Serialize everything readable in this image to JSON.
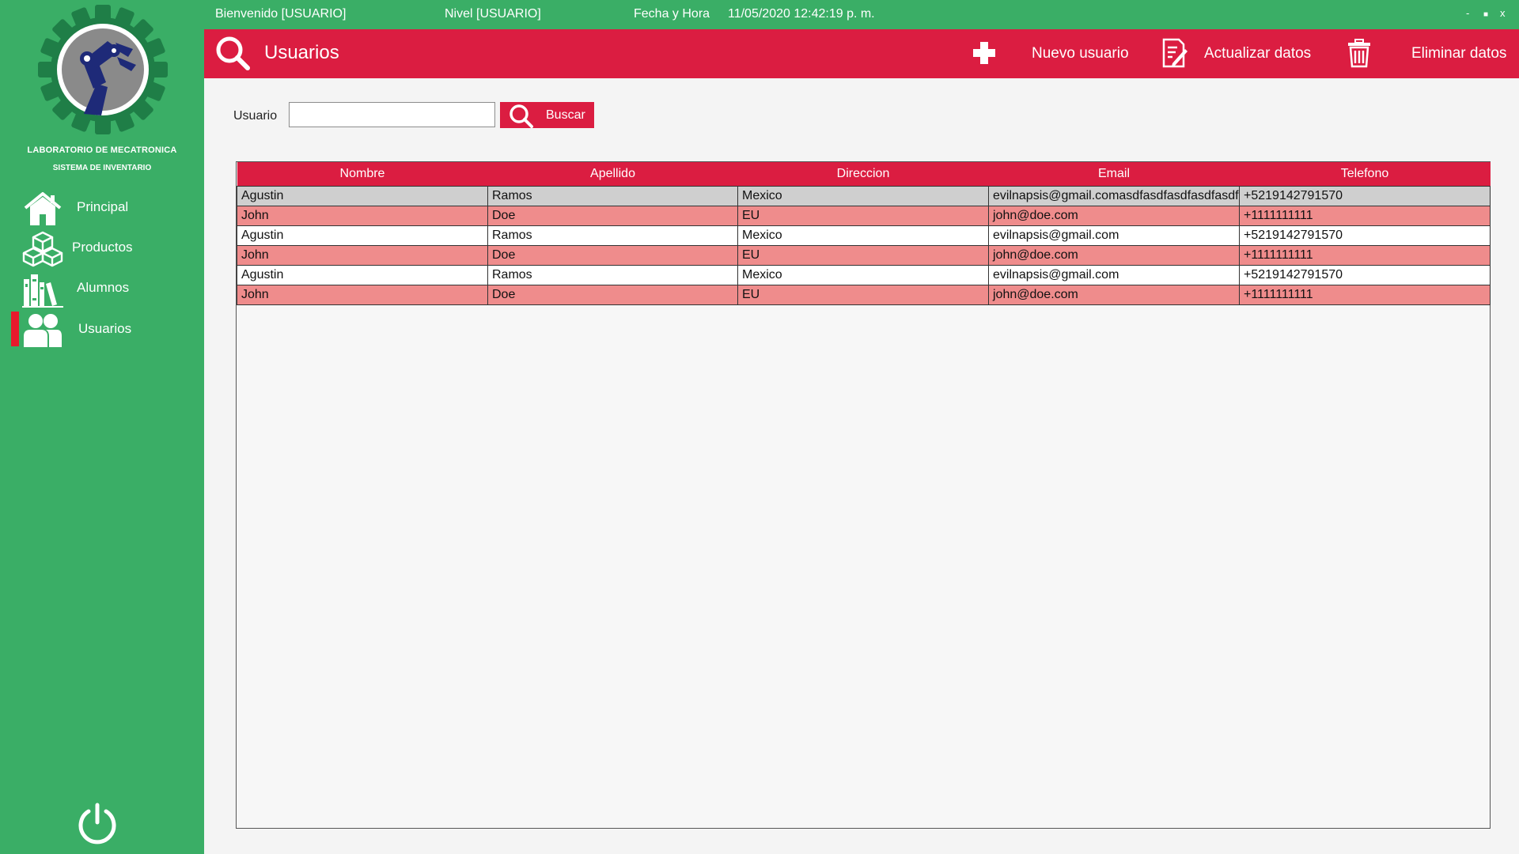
{
  "sidebar": {
    "brand_title": "LABORATORIO DE MECATRONICA",
    "brand_subtitle": "SISTEMA DE INVENTARIO",
    "items": [
      {
        "label": "Principal",
        "icon": "house-icon"
      },
      {
        "label": "Productos",
        "icon": "boxes-icon"
      },
      {
        "label": "Alumnos",
        "icon": "books-icon"
      },
      {
        "label": "Usuarios",
        "icon": "users-icon"
      }
    ],
    "active_index": 3,
    "power_icon": "power-icon"
  },
  "titlebar": {
    "welcome": "Bienvenido [USUARIO]",
    "level": "Nivel [USUARIO]",
    "datetime_label": "Fecha y Hora",
    "datetime_value": "11/05/2020 12:42:19 p. m.",
    "minimize": "-",
    "maximize": "■",
    "close": "x"
  },
  "header": {
    "title": "Usuarios",
    "new_user": "Nuevo usuario",
    "update_data": "Actualizar datos",
    "delete_data": "Eliminar datos"
  },
  "search": {
    "label": "Usuario",
    "value": "",
    "button": "Buscar"
  },
  "table": {
    "columns": [
      "Nombre",
      "Apellido",
      "Direccion",
      "Email",
      "Telefono"
    ],
    "rows": [
      [
        "Agustin",
        "Ramos",
        "Mexico",
        "evilnapsis@gmail.comasdfasdfasdfasdfasdf",
        "+5219142791570"
      ],
      [
        "John",
        "Doe",
        "EU",
        "john@doe.com",
        "+1111111111"
      ],
      [
        "Agustin",
        "Ramos",
        "Mexico",
        "evilnapsis@gmail.com",
        "+5219142791570"
      ],
      [
        "John",
        "Doe",
        "EU",
        "john@doe.com",
        "+1111111111"
      ],
      [
        "Agustin",
        "Ramos",
        "Mexico",
        "evilnapsis@gmail.com",
        "+5219142791570"
      ],
      [
        "John",
        "Doe",
        "EU",
        "john@doe.com",
        "+1111111111"
      ]
    ],
    "row_styles": [
      "r-gray",
      "r-pink",
      "r-white",
      "r-pink",
      "r-white",
      "r-pink"
    ]
  },
  "colors": {
    "sidebar_green": "#3aae66",
    "header_red": "#db1d41",
    "row_pink": "#ef8c8c",
    "row_selected": "#cfcfcf"
  }
}
